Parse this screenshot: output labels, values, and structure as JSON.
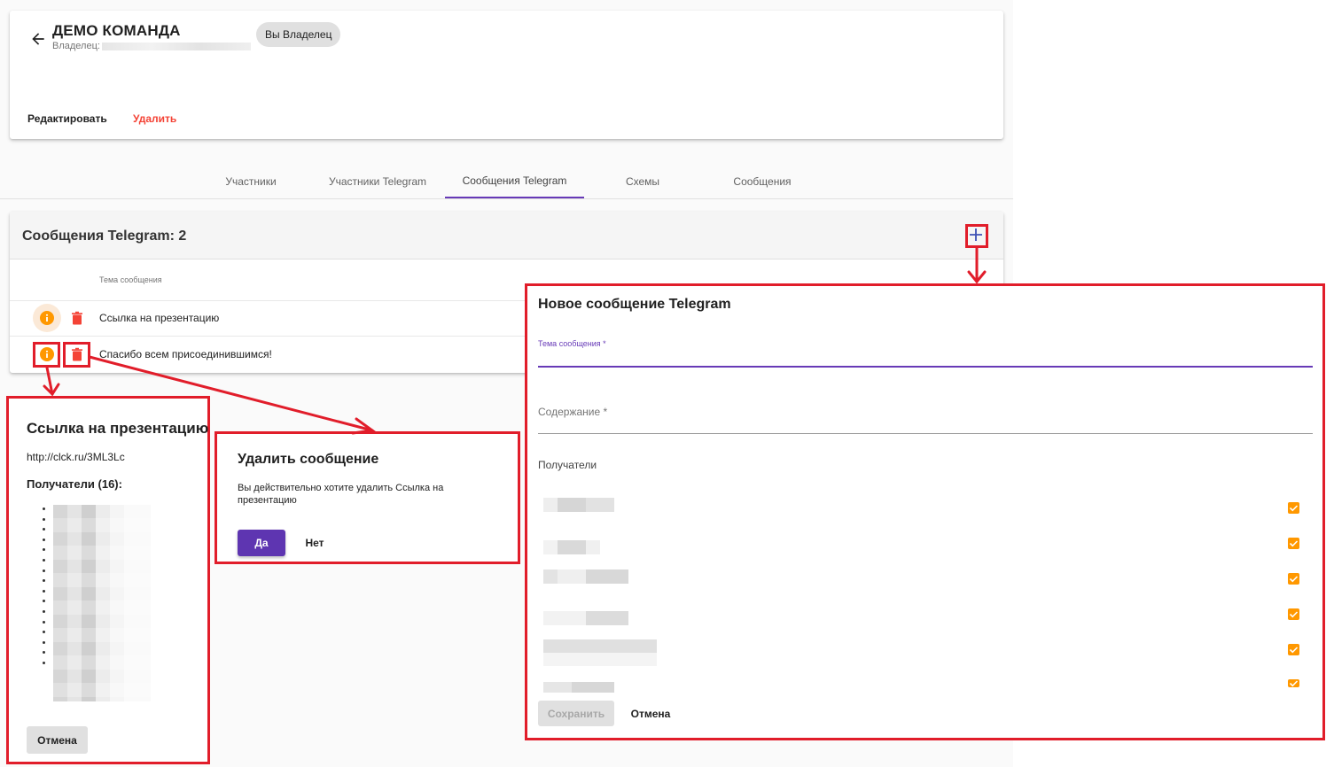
{
  "team": {
    "title": "ДЕМО КОМАНДА",
    "owner_label": "Владелец:",
    "owner_chip": "Вы Владелец",
    "edit_label": "Редактировать",
    "delete_label": "Удалить"
  },
  "tabs": [
    {
      "label": "Участники"
    },
    {
      "label": "Участники Telegram"
    },
    {
      "label": "Сообщения Telegram",
      "active": true
    },
    {
      "label": "Схемы"
    },
    {
      "label": "Сообщения"
    }
  ],
  "messages": {
    "title": "Сообщения Telegram: 2",
    "column_header": "Тема сообщения",
    "rows": [
      {
        "subject": "Ссылка на презентацию"
      },
      {
        "subject": "Спасибо всем присоединившимся!"
      }
    ]
  },
  "info_dialog": {
    "title": "Ссылка на презентацию",
    "link": "http://clck.ru/3ML3Lc",
    "recipients_label": "Получатели (16):",
    "cancel_label": "Отмена"
  },
  "delete_dialog": {
    "title": "Удалить сообщение",
    "text": "Вы действительно хотите удалить Ссылка на презентацию",
    "yes_label": "Да",
    "no_label": "Нет"
  },
  "new_dialog": {
    "title": "Новое сообщение Telegram",
    "subject_label": "Тема сообщения *",
    "content_label": "Содержание *",
    "recipients_label": "Получатели",
    "save_label": "Сохранить",
    "cancel_label": "Отмена"
  },
  "colors": {
    "accent": "#673ab7",
    "primary_button": "#5e35b1",
    "danger": "#f44336",
    "info": "#ff9800",
    "highlight": "#e11d2a"
  }
}
